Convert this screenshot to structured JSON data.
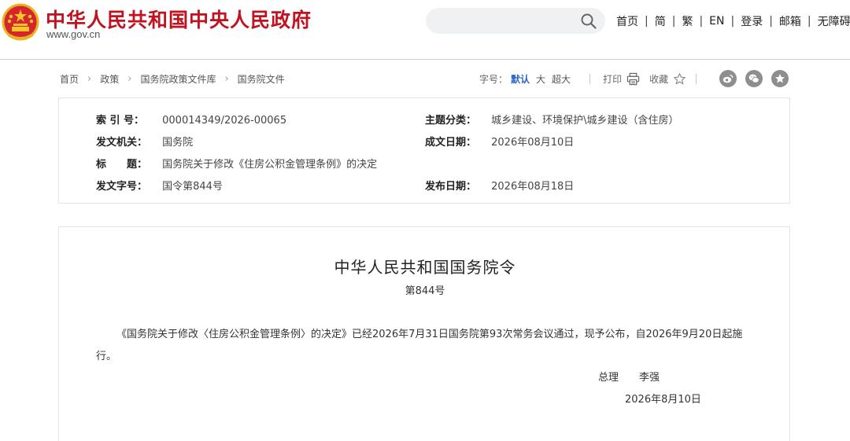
{
  "header": {
    "title": "中华人民共和国中央人民政府",
    "url": "www.gov.cn",
    "search_placeholder": "",
    "nav": [
      "首页",
      "简",
      "繁",
      "EN",
      "登录",
      "邮箱",
      "无障碍"
    ]
  },
  "breadcrumb": [
    "首页",
    "政策",
    "国务院政策文件库",
    "国务院文件"
  ],
  "tools": {
    "font_size_label": "字号：",
    "font_sizes": [
      "默认",
      "大",
      "超大"
    ],
    "print_label": "打印",
    "favorite_label": "收藏"
  },
  "meta": {
    "index_label": "索 引 号：",
    "index_value": "000014349/2026-00065",
    "topic_label": "主题分类：",
    "topic_value": "城乡建设、环境保护\\城乡建设（含住房）",
    "issuer_label": "发文机关：",
    "issuer_value": "国务院",
    "created_label": "成文日期：",
    "created_value": "2026年08月10日",
    "title_label": "标　　题：",
    "title_value": "国务院关于修改《住房公积金管理条例》的决定",
    "doc_no_label": "发文字号：",
    "doc_no_value": "国令第844号",
    "published_label": "发布日期：",
    "published_value": "2026年08月18日"
  },
  "article": {
    "title": "中华人民共和国国务院令",
    "number": "第844号",
    "body": "《国务院关于修改〈住房公积金管理条例〉的决定》已经2026年7月31日国务院第93次常务会议通过，现予公布，自2026年9月20日起施行。",
    "signer_title": "总理",
    "signer_name": "李强",
    "date": "2026年8月10日"
  },
  "colors": {
    "brand_red": "#c1121f",
    "accent_blue": "#2b65c4",
    "share_gray": "#8e8e8e"
  },
  "icons": [
    "national-emblem-icon",
    "search-icon",
    "printer-icon",
    "star-outline-icon",
    "weibo-icon",
    "wechat-icon",
    "star-circle-icon"
  ]
}
